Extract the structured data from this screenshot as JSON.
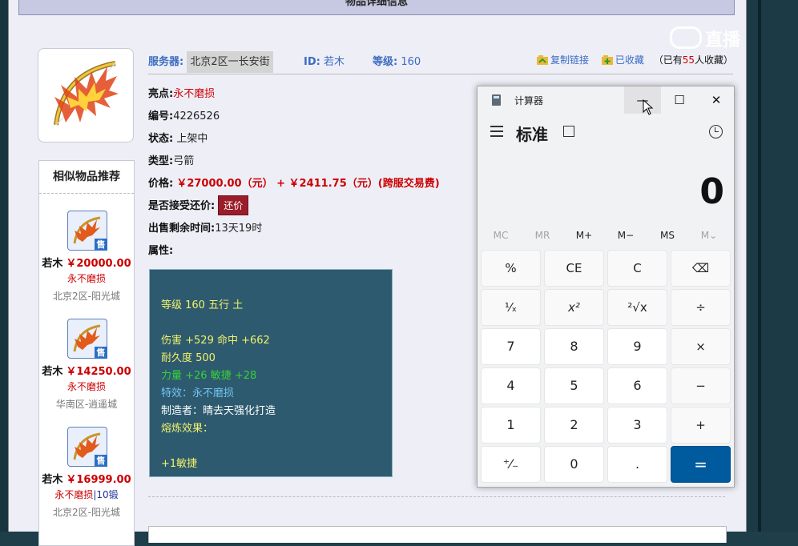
{
  "page": {
    "header_title": "物品详细信息",
    "top_info": {
      "server_label": "服务器:",
      "server_value": "北京2区一长安街",
      "id_label": "ID:",
      "id_value": "若木",
      "level_label": "等级:",
      "level_value": "160",
      "copy_link": "复制链接",
      "favorited": "已收藏",
      "fav_count_prefix": "（已有",
      "fav_count": "55",
      "fav_count_suffix": "人收藏）"
    },
    "details": {
      "highlight_label": "亮点:",
      "highlight_value": "永不磨损",
      "number_label": "编号:",
      "number_value": "4226526",
      "status_label": "状态:",
      "status_value": "上架中",
      "type_label": "类型:",
      "type_value": "弓箭",
      "price_label": "价格:",
      "price_value": "￥27000.00（元） + ￥2411.75（元）(跨服交易费)",
      "bargain_label": "是否接受还价:",
      "bargain_button": "还价",
      "remaining_label": "出售剩余时间:",
      "remaining_value": "13天19时",
      "attr_label": "属性:"
    },
    "attributes": {
      "line1": "等级 160 五行 土",
      "line2": "伤害 +529 命中 +662",
      "line3": "耐久度 500",
      "line4": "力量 +26 敏捷 +28",
      "line5": "特效：永不磨损",
      "line6": "制造者：晴去天强化打造",
      "line7": "熔炼效果：",
      "line8": "+1敏捷"
    },
    "similar": {
      "title": "相似物品推荐",
      "sold_tag": "售",
      "items": [
        {
          "name": "若木",
          "price": "￥20000.00",
          "tag": "永不磨损",
          "level_tag": "",
          "server": "北京2区-阳光城"
        },
        {
          "name": "若木",
          "price": "￥14250.00",
          "tag": "永不磨损",
          "level_tag": "",
          "server": "华南区-逍遥城"
        },
        {
          "name": "若木",
          "price": "￥16999.00",
          "tag": "永不磨损",
          "level_tag": "|10锻",
          "server": "北京2区-阳光城"
        }
      ]
    }
  },
  "watermark": {
    "text": "直播"
  },
  "calculator": {
    "app_title": "计算器",
    "mode": "标准",
    "display": "0",
    "window_buttons": {
      "minimize": "—",
      "maximize": "☐",
      "close": "✕"
    },
    "memory": [
      "MC",
      "MR",
      "M+",
      "M−",
      "MS",
      "M⌄"
    ],
    "keys": [
      [
        "%",
        "CE",
        "C",
        "⌫"
      ],
      [
        "¹⁄ₓ",
        "x²",
        "²√x",
        "÷"
      ],
      [
        "7",
        "8",
        "9",
        "×"
      ],
      [
        "4",
        "5",
        "6",
        "−"
      ],
      [
        "1",
        "2",
        "3",
        "+"
      ],
      [
        "⁺⁄₋",
        "0",
        ".",
        "="
      ]
    ]
  },
  "colors": {
    "accent_blue": "#3a6cc0",
    "price_red": "#cc0000",
    "calc_equals": "#005a9e",
    "attr_bg": "#2d5a6f"
  }
}
